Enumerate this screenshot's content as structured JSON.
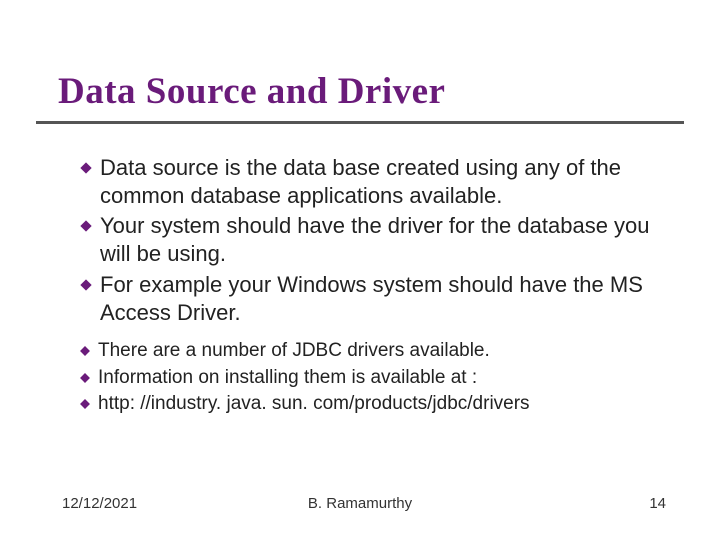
{
  "title": "Data Source and Driver",
  "bullets_main": [
    "Data source is the data base created using any of the common database applications available.",
    "Your system should have the driver for the database you will be using.",
    "For example your Windows system should have the MS Access Driver."
  ],
  "bullets_sub": [
    "There are a number of JDBC drivers available.",
    "Information on installing them is available at :",
    "http: //industry. java. sun. com/products/jdbc/drivers"
  ],
  "footer": {
    "date": "12/12/2021",
    "author": "B. Ramamurthy",
    "page": "14"
  },
  "colors": {
    "title": "#6a1b7a",
    "bullet": "#6a1b7a"
  }
}
